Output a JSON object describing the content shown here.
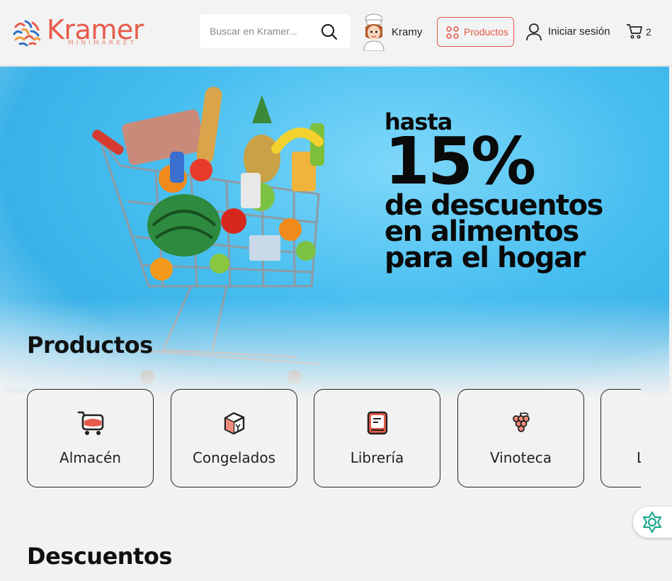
{
  "header": {
    "logo": {
      "word": "Kramer",
      "sub": "MINIMARKET"
    },
    "search": {
      "placeholder": "Buscar en Kramer..."
    },
    "assistant": {
      "label": "Kramy"
    },
    "products_button": "Productos",
    "login_label": "Iniciar sesión",
    "cart_count": "2"
  },
  "banner": {
    "hasta": "hasta",
    "percent": "15%",
    "line1": "de descuentos",
    "line2": "en alimentos",
    "line3": "para el hogar",
    "code": "1321166"
  },
  "sections": {
    "products_title": "Productos",
    "discounts_title": "Descuentos"
  },
  "categories": [
    {
      "label": "Almacén",
      "icon": "shopping-cart-icon"
    },
    {
      "label": "Congelados",
      "icon": "frozen-box-icon"
    },
    {
      "label": "Librería",
      "icon": "book-icon"
    },
    {
      "label": "Vinoteca",
      "icon": "grapes-icon"
    },
    {
      "label": "L",
      "icon": "partial-icon"
    }
  ],
  "colors": {
    "brand": "#e65b4a",
    "banner_sky": "#45bdef",
    "assistant": "#1aa88a"
  }
}
